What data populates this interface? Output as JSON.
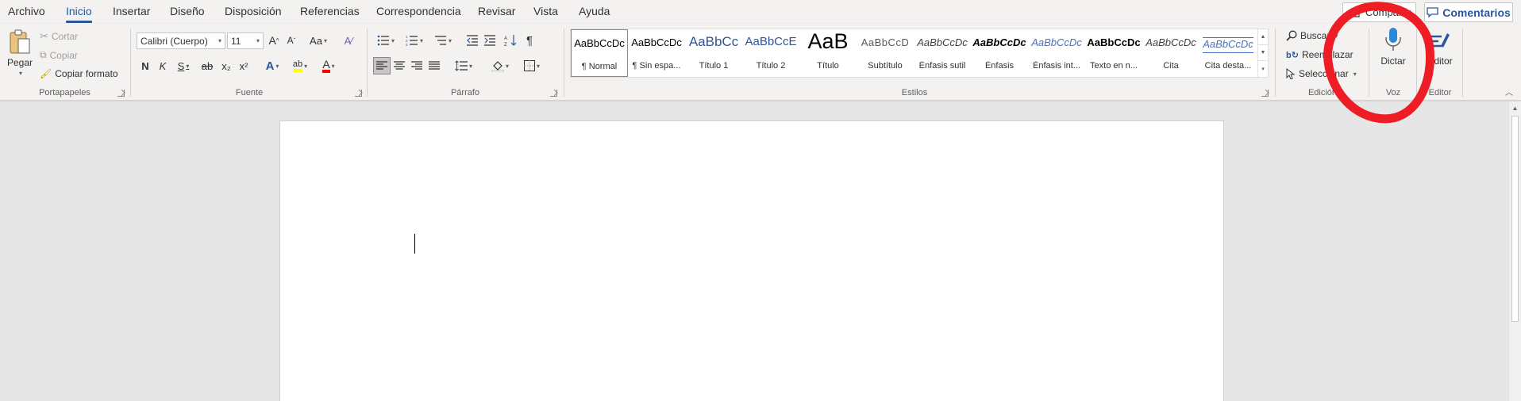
{
  "tabs": [
    "Archivo",
    "Inicio",
    "Insertar",
    "Diseño",
    "Disposición",
    "Referencias",
    "Correspondencia",
    "Revisar",
    "Vista",
    "Ayuda"
  ],
  "active_tab": "Inicio",
  "top_right": {
    "share_label": "Compartir",
    "comments_label": "Comentarios"
  },
  "clipboard": {
    "paste": "Pegar",
    "cut": "Cortar",
    "copy": "Copiar",
    "format_painter": "Copiar formato",
    "label": "Portapapeles"
  },
  "font": {
    "family": "Calibri (Cuerpo)",
    "size": "11",
    "bold": "N",
    "italic": "K",
    "underline": "S",
    "strike": "ab",
    "subscript": "x₂",
    "superscript": "x²",
    "case": "Aa",
    "grow": "A",
    "shrink": "A",
    "text_effects": "A",
    "highlight": "ab",
    "color": "A",
    "label": "Fuente"
  },
  "paragraph": {
    "label": "Párrafo",
    "pilcrow": "¶"
  },
  "styles": {
    "label": "Estilos",
    "items": [
      {
        "sample": "AaBbCcDc",
        "name": "¶ Normal"
      },
      {
        "sample": "AaBbCcDc",
        "name": "¶ Sin espa..."
      },
      {
        "sample": "AaBbCc",
        "name": "Título 1"
      },
      {
        "sample": "AaBbCcE",
        "name": "Título 2"
      },
      {
        "sample": "AaB",
        "name": "Título"
      },
      {
        "sample": "AaBbCcD",
        "name": "Subtítulo"
      },
      {
        "sample": "AaBbCcDc",
        "name": "Énfasis sutil"
      },
      {
        "sample": "AaBbCcDc",
        "name": "Énfasis"
      },
      {
        "sample": "AaBbCcDc",
        "name": "Énfasis int..."
      },
      {
        "sample": "AaBbCcDc",
        "name": "Texto en n..."
      },
      {
        "sample": "AaBbCcDc",
        "name": "Cita"
      },
      {
        "sample": "AaBbCcDc",
        "name": "Cita desta..."
      }
    ]
  },
  "editing": {
    "find": "Buscar",
    "replace": "Reemplazar",
    "select": "Seleccionar",
    "label": "Edición"
  },
  "voice": {
    "dictate": "Dictar",
    "label": "Voz"
  },
  "editor": {
    "button": "Editor",
    "label": "Editor"
  },
  "colors": {
    "accent": "#2b579a",
    "annotation": "#ee1c24",
    "highlight": "#ffff00",
    "font_color": "#ff0000"
  }
}
